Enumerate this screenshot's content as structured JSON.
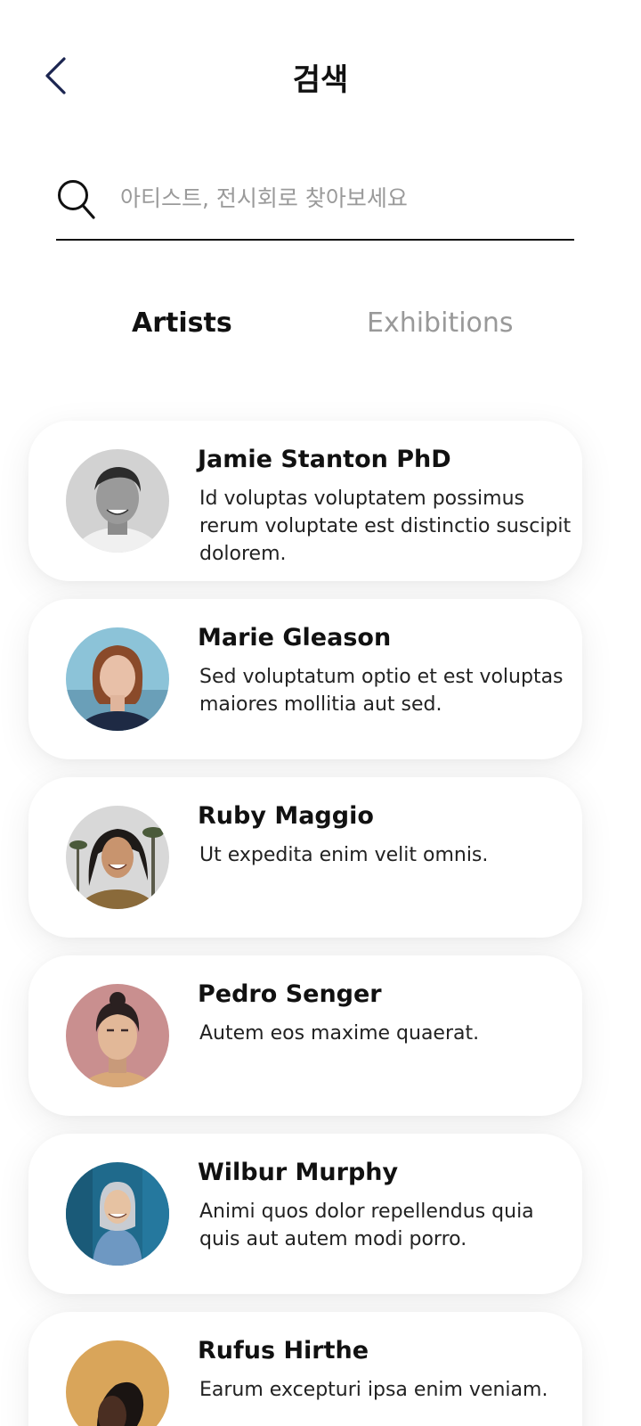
{
  "header": {
    "title": "검색",
    "back_icon": "chevron-left-icon"
  },
  "search": {
    "placeholder": "아티스트, 전시회로 찾아보세요",
    "value": "",
    "icon": "search-icon"
  },
  "tabs": [
    {
      "label": "Artists",
      "active": true
    },
    {
      "label": "Exhibitions",
      "active": false
    }
  ],
  "artists": [
    {
      "name": "Jamie Stanton PhD",
      "description": "Id voluptas voluptatem possimus rerum voluptate est distinctio suscipit dolorem.",
      "avatar_bg": "#b9b9b9"
    },
    {
      "name": "Marie Gleason",
      "description": "Sed voluptatum optio et est voluptas maiores mollitia aut sed.",
      "avatar_bg": "#7fb4c8"
    },
    {
      "name": "Ruby Maggio",
      "description": "Ut expedita enim velit omnis.",
      "avatar_bg": "#c9c9c9"
    },
    {
      "name": "Pedro Senger",
      "description": "Autem eos maxime quaerat.",
      "avatar_bg": "#c98f8f"
    },
    {
      "name": "Wilbur Murphy",
      "description": "Animi quos dolor repellendus quia quis aut autem modi porro.",
      "avatar_bg": "#1f6a8c"
    },
    {
      "name": "Rufus Hirthe",
      "description": "Earum excepturi ipsa enim veniam.",
      "avatar_bg": "#d9a55a"
    }
  ],
  "colors": {
    "text": "#111111",
    "tab_inactive": "#999999",
    "placeholder": "#9a9a9a",
    "back_icon": "#1b2550"
  }
}
